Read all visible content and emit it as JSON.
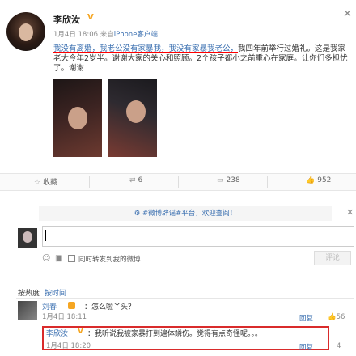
{
  "post": {
    "author": "李欣汝",
    "verified_mark": "V",
    "date": "1月4日 18:06",
    "source_prefix": "来自",
    "source": "iPhone客户端",
    "text_highlight": "我没有离婚，我老公没有家暴我，我没有家暴我老公，",
    "text_rest": "我四年前举行过婚礼。这是我家老大今年2岁半。谢谢大家的关心和照顾。2个孩子都小之前重心在家庭。让你们多担忧了。谢谢",
    "close_glyph": "✕"
  },
  "actions": {
    "favorite": "收藏",
    "repost": "6",
    "comment": "238",
    "like": "952"
  },
  "notice": {
    "text": "#微博辟谣#平台，欢迎查阅！",
    "close_glyph": "✕"
  },
  "composer": {
    "placeholder": "",
    "repost_label": "同时转发到我的微博",
    "submit_label": "评论"
  },
  "sort": {
    "hot": "按热度",
    "time": "按时间"
  },
  "comments": [
    {
      "name": "刘春",
      "text": "：怎么啦丫头？",
      "time": "1月4日 18:11",
      "reply": "回复",
      "likes": "56"
    },
    {
      "name": "李欣汝",
      "verified_mark": "V",
      "text": "：我听说我被家暴打到遍体鳞伤。觉得有点奇怪呢。。。",
      "time": "1月4日 18:20",
      "reply": "回复",
      "likes": "4"
    }
  ],
  "colors": {
    "link": "#3a6fb0",
    "highlight": "#d92b2b",
    "verified": "#f5a623"
  }
}
